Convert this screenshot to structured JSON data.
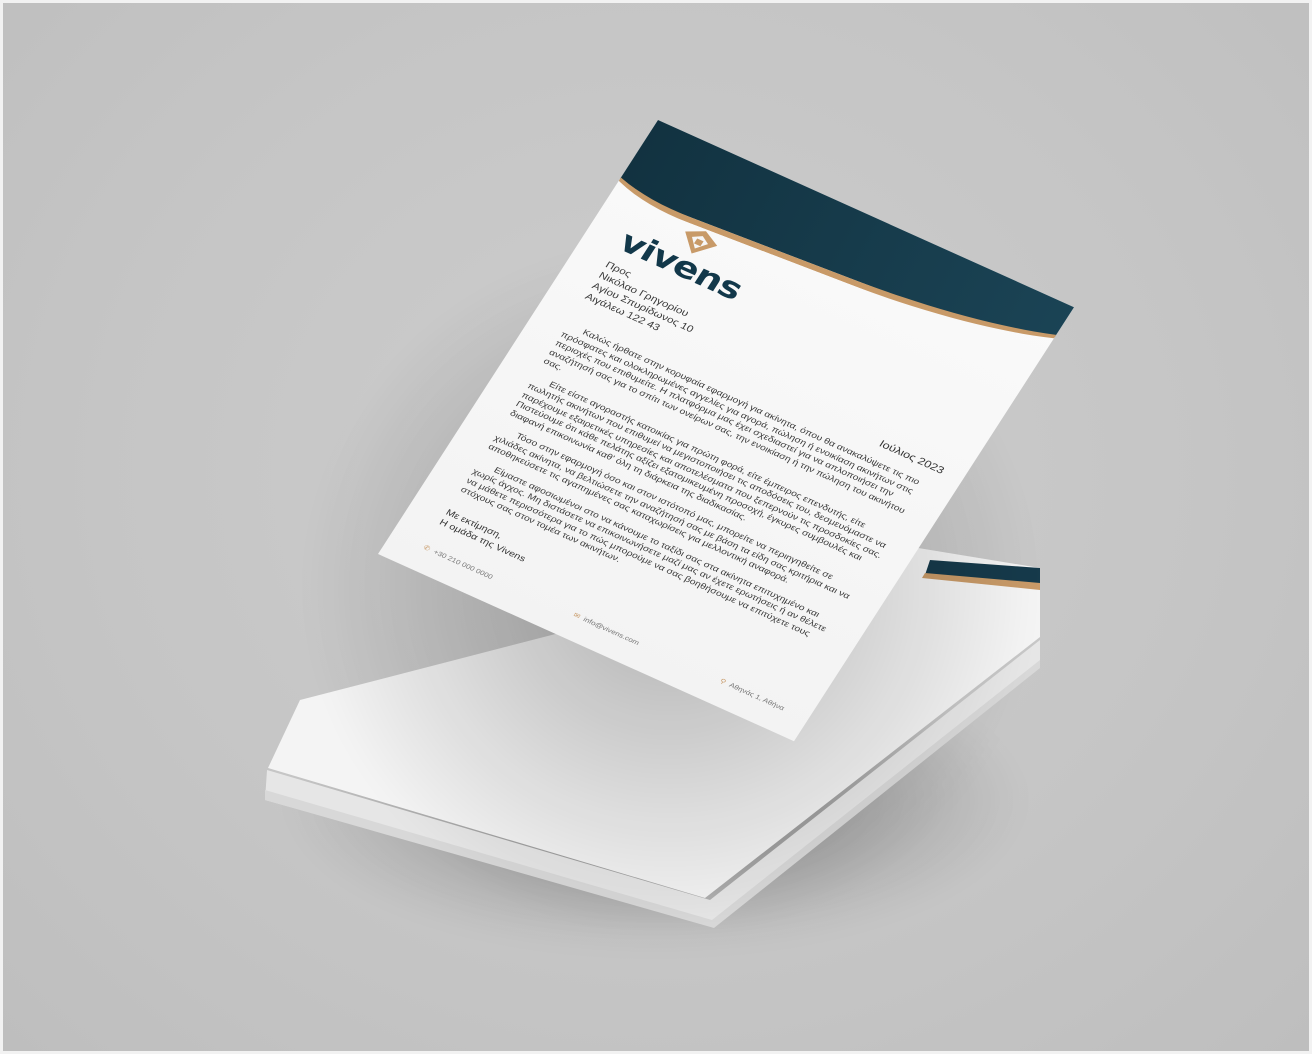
{
  "colors": {
    "background": "#c6c6c6",
    "band": "#11313f",
    "accent": "#c89a68",
    "paper": "#f6f6f6"
  },
  "brand": {
    "name": "vivens",
    "logo_icon": "house-shield-icon"
  },
  "letter": {
    "recipient": [
      "Προς",
      "Νικόλαο Γρηγορίου",
      "Αγίου Σπυρίδωνος 10",
      "Αιγάλεω 122 43"
    ],
    "date": "Ιούλιος 2023",
    "paragraphs": [
      "Καλώς ήρθατε στην κορυφαία εφαρμογή για ακίνητα, όπου θα ανακαλύψετε τις πιο πρόσφατες και ολοκληρωμένες αγγελίες για αγορά, πώληση ή ενοικίαση ακινήτων στις περιοχές που επιθυμείτε. Η πλατφόρμα μας έχει σχεδιαστεί για να απλοποιήσει την αναζήτησή σας για το σπίτι των ονείρων σας, την ενοικίαση ή την πώληση του ακινήτου σας.",
      "Είτε είστε αγοραστής κατοικίας για πρώτη φορά, είτε έμπειρος επενδυτής, είτε πωλητής ακινήτων που επιθυμεί να μεγιστοποιήσει τις αποδόσεις του, δεσμευόμαστε να παρέχουμε εξαιρετικές υπηρεσίες και αποτελέσματα που ξεπερνούν τις προσδοκίες σας. Πιστεύουμε ότι κάθε πελάτης αξίζει εξατομικευμένη προσοχή, έγκυρες συμβουλές και διαφανή επικοινωνία καθ' όλη τη διάρκεια της διαδικασίας.",
      "Τόσο στην εφαρμογή όσο και στον ιστότοπό μας, μπορείτε να περιηγηθείτε σε χιλιάδες ακίνητα, να βελτιώσετε την αναζήτησή σας με βάση τα είδη σας κριτήρια και να αποθηκεύσετε τις αγαπημένες σας καταχωρίσεις για μελλοντική αναφορά.",
      "Είμαστε αφοσιωμένοι στο να κάνουμε το ταξίδι σας στα ακίνητα επιτυχημένο και χωρίς άγχος. Μη διστάσετε να επικοινωνήσετε μαζί μας αν έχετε ερωτήσεις ή αν θέλετε να μάθετε περισσότερα για το πώς μπορούμε να σας βοηθήσουμε να επιτύχετε τους στόχους σας στον τομέα των ακινήτων."
    ],
    "closing": "Με εκτίμηση,",
    "signature": "Η ομάδα της Vivens"
  },
  "footer": {
    "phone": "+30 210 000 0000",
    "email": "info@vivens.com",
    "address": "Αθηνάς 1, Αθήνα",
    "phone_icon": "phone-icon",
    "email_icon": "mail-icon",
    "address_icon": "location-pin-icon"
  }
}
